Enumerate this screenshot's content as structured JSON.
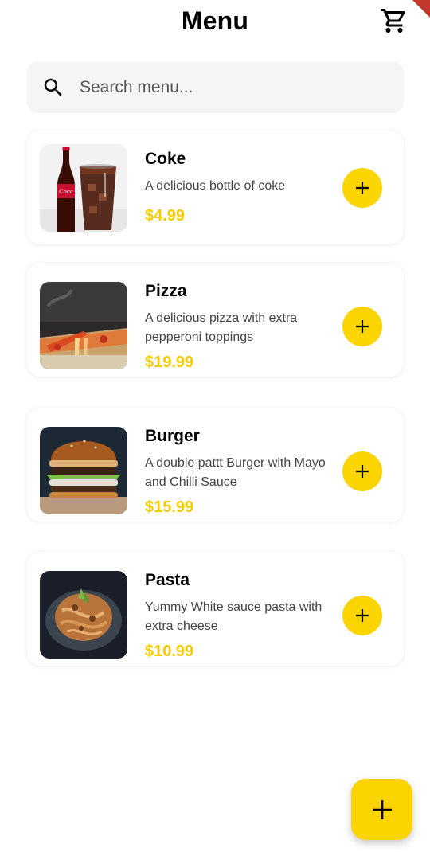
{
  "header": {
    "title": "Menu",
    "cart_icon": "shopping-cart-icon"
  },
  "search": {
    "placeholder": "Search menu...",
    "value": "",
    "icon": "search-icon"
  },
  "theme": {
    "accent": "#fcd500",
    "price_color": "#f5cc00",
    "search_bg": "#f5f5f5"
  },
  "items": [
    {
      "name": "Coke",
      "description": "A delicious bottle of coke",
      "price": "$4.99",
      "image": "coke-image"
    },
    {
      "name": "Pizza",
      "description": "A delicious pizza with extra pepperoni toppings",
      "price": "$19.99",
      "image": "pizza-image"
    },
    {
      "name": "Burger",
      "description": "A double pattt Burger with Mayo and Chilli Sauce",
      "price": "$15.99",
      "image": "burger-image"
    },
    {
      "name": "Pasta",
      "description": "Yummy White sauce pasta with extra cheese",
      "price": "$10.99",
      "image": "pasta-image"
    }
  ],
  "fab": {
    "icon": "plus-icon"
  }
}
